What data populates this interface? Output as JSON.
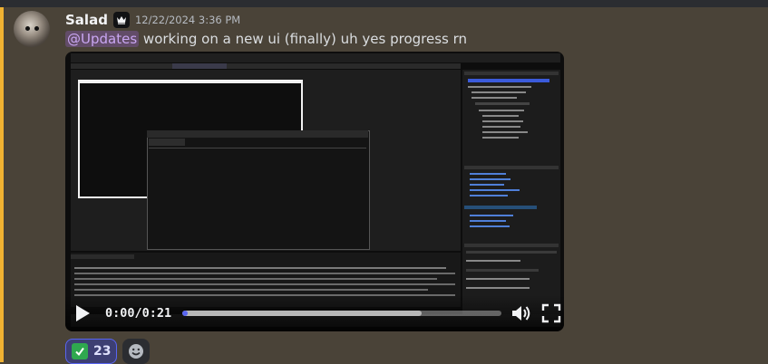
{
  "message": {
    "author": "Salad",
    "timestamp": "12/22/2024 3:36 PM",
    "mention": "@Updates",
    "text": "working on a new ui (finally) uh yes progress rn"
  },
  "video": {
    "current_time": "0:00",
    "separator": "/",
    "duration": "0:21",
    "progress_fraction": 0.0,
    "buffered_fraction": 0.75
  },
  "reactions": [
    {
      "emoji": "check-mark-button",
      "count": "23"
    }
  ],
  "colors": {
    "background": "#4a4338",
    "accent": "#5865f2",
    "mention_text": "#c9a6f2"
  }
}
